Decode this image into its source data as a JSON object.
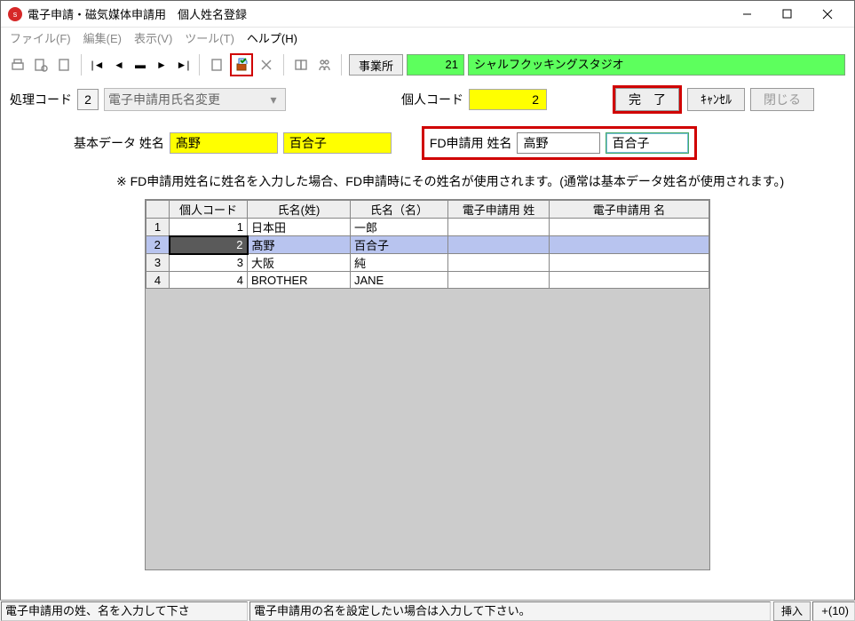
{
  "window": {
    "title": "電子申請・磁気媒体申請用　個人姓名登録"
  },
  "menu": {
    "file": "ファイル(F)",
    "edit": "編集(E)",
    "view": "表示(V)",
    "tool": "ツール(T)",
    "help": "ヘルプ(H)"
  },
  "toolbar": {
    "jigyo_label": "事業所",
    "jigyo_code": "21",
    "jigyo_name": "シャルフクッキングスタジオ"
  },
  "form": {
    "shori_label": "処理コード",
    "shori_value": "2",
    "shori_combo": "電子申請用氏名変更",
    "kojin_label": "個人コード",
    "kojin_value": "2",
    "complete": "完　了",
    "cancel": "ｷｬﾝｾﾙ",
    "close": "閉じる",
    "base_label": "基本データ 姓名",
    "base_sei": "髙野",
    "base_mei": "百合子",
    "fd_label": "FD申請用 姓名",
    "fd_sei": "高野",
    "fd_mei": "百合子"
  },
  "note": "※  FD申請用姓名に姓名を入力した場合、FD申請時にその姓名が使用されます。(通常は基本データ姓名が使用されます。)",
  "grid": {
    "headers": [
      "",
      "個人コード",
      "氏名(姓)",
      "氏名（名）",
      "電子申請用 姓",
      "電子申請用 名"
    ],
    "rows": [
      {
        "n": "1",
        "code": "1",
        "sei": "日本田",
        "mei": "一郎",
        "esei": "",
        "emei": ""
      },
      {
        "n": "2",
        "code": "2",
        "sei": "髙野",
        "mei": "百合子",
        "esei": "",
        "emei": "",
        "selected": true
      },
      {
        "n": "3",
        "code": "3",
        "sei": "大阪",
        "mei": "純",
        "esei": "",
        "emei": ""
      },
      {
        "n": "4",
        "code": "4",
        "sei": "BROTHER",
        "mei": "JANE",
        "esei": "",
        "emei": ""
      }
    ]
  },
  "status": {
    "left": "電子申請用の姓、名を入力して下さ",
    "mid": "電子申請用の名を設定したい場合は入力して下さい。",
    "insert": "挿入",
    "count": "+(10)"
  }
}
